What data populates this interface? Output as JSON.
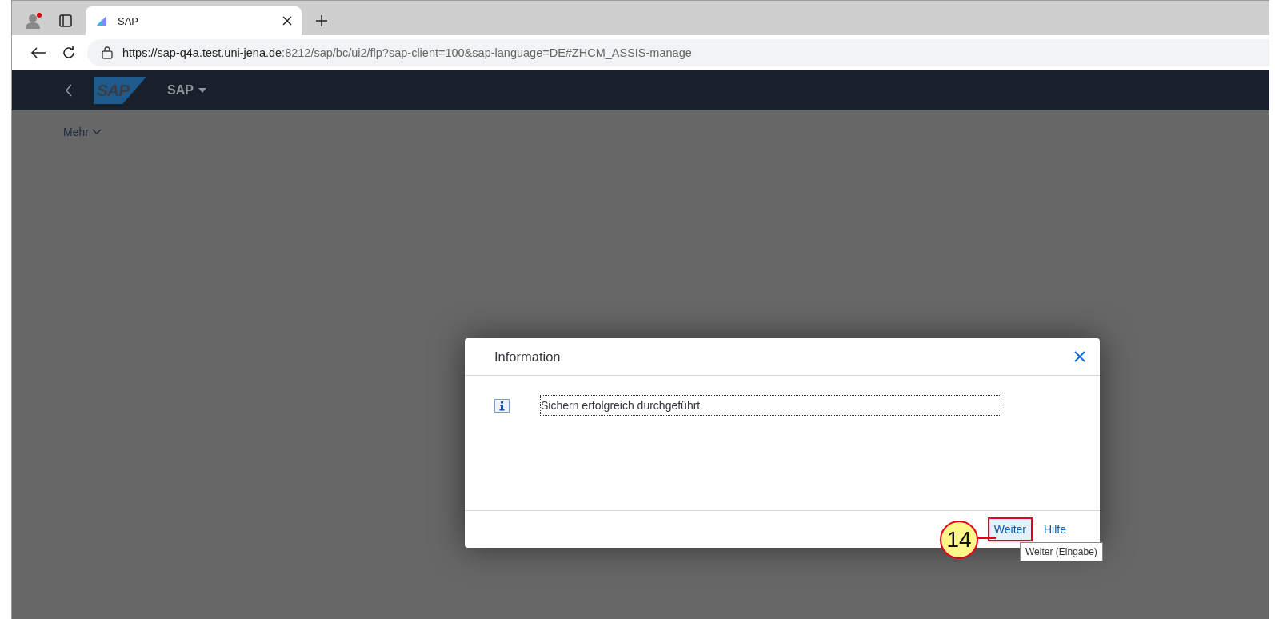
{
  "browser": {
    "tab": {
      "title": "SAP",
      "selected": true
    },
    "url_host": "https://sap-q4a.test.uni-jena.de",
    "url_path": ":8212/sap/bc/ui2/flp?sap-client=100&sap-language=DE#ZHCM_ASSIS-manage"
  },
  "shell": {
    "logo": "SAP",
    "title": "SAP"
  },
  "page": {
    "more": "Mehr"
  },
  "dialog": {
    "title": "Information",
    "message": "Sichern erfolgreich durchgeführt",
    "buttons": [
      {
        "label": "Weiter",
        "selected": true
      },
      {
        "label": "Hilfe",
        "selected": false
      }
    ],
    "tooltip": "Weiter (Eingabe)"
  },
  "annotation": {
    "number": "14"
  }
}
